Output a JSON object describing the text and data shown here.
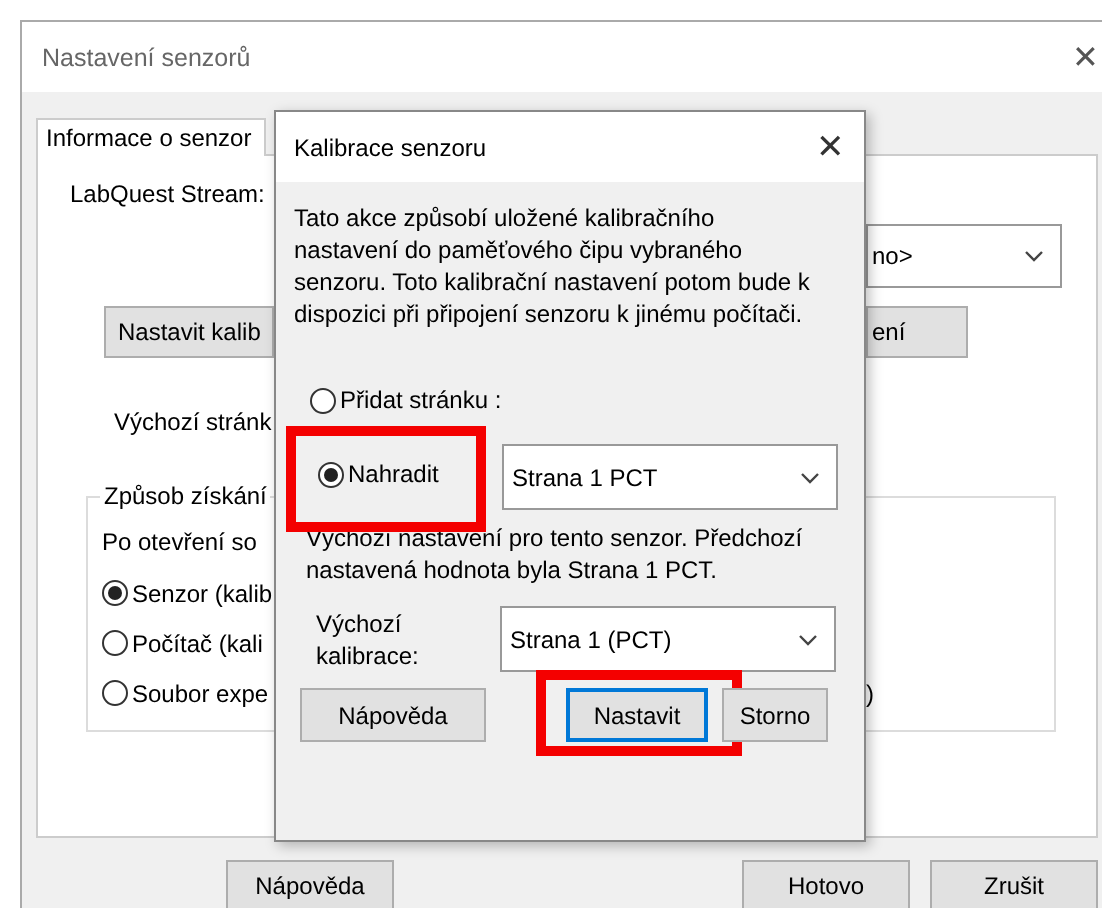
{
  "window": {
    "title": "Nastavení senzorů",
    "close": "✕"
  },
  "tabs": [
    {
      "label": "Informace o senzor",
      "selected": true
    }
  ],
  "panel": {
    "stream_label": "LabQuest Stream:",
    "stream_dropdown": "no>",
    "calibrate_button": "Nastavit kalib",
    "second_button": "ení",
    "default_page_label": "Výchozí stránk",
    "group": {
      "legend": "Způsob získání",
      "prompt": "Po otevření so",
      "options": [
        {
          "label": "Senzor (kalib",
          "selected": true
        },
        {
          "label": "Počítač (kali",
          "selected": false
        },
        {
          "label": "Soubor expe",
          "selected": false
        }
      ],
      "trailing": ")"
    }
  },
  "buttons": [
    "Nápověda",
    "Hotovo",
    "Zrušit"
  ],
  "dialog": {
    "title": "Kalibrace senzoru",
    "close": "✕",
    "message": "Tato akce způsobí uložené kalibračního nastavení do paměťového čipu vybraného senzoru. Toto kalibrační nastavení potom bude k dispozici při připojení senzoru k jinému počítači.",
    "options": [
      {
        "label": "Přidat stránku :",
        "selected": false,
        "highlighted": false
      },
      {
        "label": "Nahradit",
        "selected": true,
        "highlighted": true
      }
    ],
    "page_dropdown": "Strana 1 PCT",
    "note": "Výchozí nastavení pro tento senzor. Předchozí nastavená hodnota byla Strana 1 PCT.",
    "calibration_label": "Výchozí kalibrace:",
    "calibration_dropdown": "Strana 1 (PCT)",
    "buttons": [
      {
        "label": "Nápověda",
        "default": false,
        "highlighted": false
      },
      {
        "label": "Nastavit",
        "default": true,
        "highlighted": true
      },
      {
        "label": "Storno",
        "default": false,
        "highlighted": false
      }
    ]
  }
}
